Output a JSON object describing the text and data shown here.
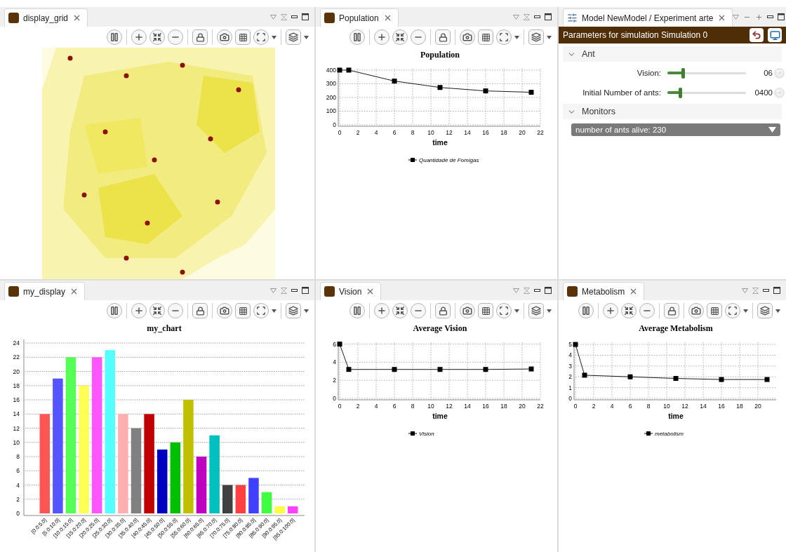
{
  "panels": [
    {
      "kind": "picture",
      "tab": {
        "title": "display_grid"
      }
    },
    {
      "kind": "chart",
      "tab": {
        "title": "Population"
      },
      "chart_data": {
        "type": "line",
        "grid": true,
        "title": "Population",
        "xlabel": "time",
        "x": [
          0,
          1,
          6,
          11,
          16,
          21
        ],
        "xlim": [
          0,
          22
        ],
        "ylim": [
          0,
          410
        ],
        "xticks": [
          0,
          2,
          4,
          6,
          8,
          10,
          12,
          14,
          16,
          18,
          20,
          22
        ],
        "yticks": [
          0,
          100,
          200,
          300,
          400
        ],
        "series": [
          {
            "name": "Quantidade de Fomigas",
            "color": "#000000",
            "marker": "square",
            "values": [
              400,
              400,
              320,
              273,
              248,
              238
            ]
          }
        ]
      }
    },
    {
      "kind": "parameters",
      "tab": {
        "title": "Model NewModel / Experiment arte"
      },
      "header": "Parameters for simulation Simulation 0",
      "sections": [
        {
          "title": "Ant",
          "expanded": true,
          "items": [
            {
              "kind": "slider",
              "label": "Vision:",
              "level": 0.2,
              "value": "06"
            },
            {
              "kind": "slider",
              "label": "Initial Number of ants:",
              "level": 0.16,
              "value": "0400"
            }
          ]
        },
        {
          "title": "Monitors",
          "expanded": true,
          "items": [
            {
              "kind": "dropdown",
              "value": "number of ants alive: 230"
            }
          ]
        }
      ]
    },
    {
      "kind": "chart",
      "tab": {
        "title": "my_display"
      },
      "chart_data": {
        "type": "bar",
        "grid": true,
        "title": "my_chart",
        "categories": [
          "[0.0:5.0]",
          "[5.0:10.0]",
          "[10.0:15.0]",
          "[15.0:20.0]",
          "[20.0:25.0]",
          "[25.0:30.0]",
          "[30.0:35.0]",
          "[35.0:40.0]",
          "[40.0:45.0]",
          "[45.0:50.0]",
          "[50.0:55.0]",
          "[55.0:60.0]",
          "[60.0:65.0]",
          "[65.0:70.0]",
          "[70.0:75.0]",
          "[75.0:80.0]",
          "[80.0:85.0]",
          "[85.0:90.0]",
          "[90.0:95.0]",
          "[95.0:100.0]"
        ],
        "ylim": [
          0,
          24.5
        ],
        "yticks": [
          0,
          2,
          4,
          6,
          8,
          10,
          12,
          14,
          16,
          18,
          20,
          22,
          24
        ],
        "series": [
          {
            "values": [
              14,
              19,
              22,
              18,
              22,
              23,
              14,
              12,
              14,
              9,
              10,
              16,
              8,
              11,
              4,
              4,
              5,
              3,
              1,
              1
            ],
            "colors": [
              "#ff5555",
              "#5555ff",
              "#55ff55",
              "#ffff55",
              "#ff55ff",
              "#55ffff",
              "#ffafaf",
              "#808080",
              "#c00000",
              "#0000c0",
              "#00c000",
              "#c0c000",
              "#c000c0",
              "#00c0c0",
              "#404040",
              "#ff4040",
              "#4040ff",
              "#40ff40",
              "#ffff40",
              "#ff40ff"
            ]
          }
        ]
      }
    },
    {
      "kind": "chart",
      "tab": {
        "title": "Vision"
      },
      "chart_data": {
        "type": "line",
        "grid": true,
        "title": "Average Vision",
        "xlabel": "time",
        "x": [
          0,
          1,
          6,
          11,
          16,
          21
        ],
        "xlim": [
          0,
          22
        ],
        "ylim": [
          0,
          6.2
        ],
        "xticks": [
          0,
          2,
          4,
          6,
          8,
          10,
          12,
          14,
          16,
          18,
          20,
          22
        ],
        "yticks": [
          0,
          2,
          4,
          6
        ],
        "series": [
          {
            "name": "Vision",
            "color": "#000000",
            "marker": "square",
            "values": [
              6,
              3.2,
              3.2,
              3.2,
              3.2,
              3.25
            ]
          }
        ]
      }
    },
    {
      "kind": "chart",
      "tab": {
        "title": "Metabolism"
      },
      "chart_data": {
        "type": "line",
        "grid": true,
        "title": "Average Metabolism",
        "xlabel": "time",
        "x": [
          0,
          1,
          6,
          11,
          16,
          21
        ],
        "xlim": [
          0,
          22
        ],
        "ylim": [
          0,
          5.2
        ],
        "xticks": [
          0,
          2,
          4,
          6,
          8,
          10,
          12,
          14,
          16,
          18,
          20
        ],
        "yticks": [
          0,
          1,
          2,
          3,
          4,
          5
        ],
        "series": [
          {
            "name": "metabolism",
            "color": "#000000",
            "marker": "square",
            "values": [
              5,
              2.15,
              2.0,
              1.85,
              1.75,
              1.75
            ]
          }
        ]
      }
    }
  ]
}
